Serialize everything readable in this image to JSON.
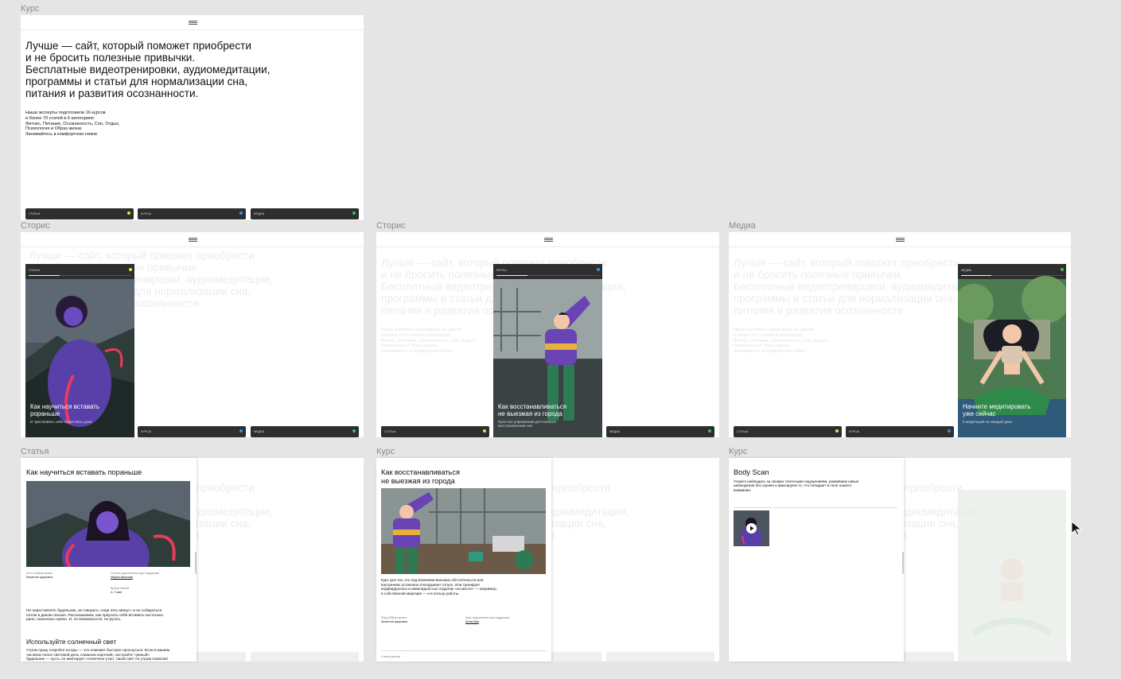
{
  "labels": {
    "kurs": "Курс",
    "storis": "Сторис",
    "media": "Медиа",
    "statya": "Статья"
  },
  "home": {
    "headline": "Лучше — сайт, который поможет приобрести\nи не бросить полезные привычки.\nБесплатные видеотренировки, аудиомедитации,\nпрограммы и статьи для нормализации сна,\nпитания и развития осознанности.",
    "intro": "Наши эксперты подготовили 16 курсов\nи более 70 статей в 6 категориях:\nФитнес, Питание, Осознанность, Сон, Отдых,\nПсихология и Образ жизни.\nЗанимайтесь в комфортном темпе."
  },
  "tabs": {
    "articles": "СТАТЬИ",
    "courses": "КУРСЫ",
    "media": "МЕДИА"
  },
  "colors": {
    "articles_dot": "#e8e04a",
    "courses_dot": "#3b8fe0",
    "media_dot": "#3cc25a",
    "tab_bg": "#2e2e2e"
  },
  "stories": {
    "s1": {
      "title": "Как научиться вставать\npораньше",
      "sub": "И чувствовать себя бодро весь день"
    },
    "s2": {
      "title": "Как восстанавливаться\nне выезжая из города",
      "sub": "Простые упражнения для полного\nвосстановления сил"
    },
    "s3": {
      "title": "Начните медитировать\nуже сейчас",
      "sub": "6 медитаций на каждый день"
    }
  },
  "article": {
    "title": "Как научиться вставать пораньше",
    "meta_cat_label": "#Сон #Образ жизни",
    "meta_cat_value": "Касается здоровья",
    "meta_expert_label": "Статья подготовлена при поддержке",
    "meta_expert_value": "Мария Иванова",
    "meta_time_label": "Время чтения",
    "meta_time_value": "4–7 мин",
    "lead": "Не переставлять будильник, не говорить «ещё пять минут» и не собираться\nпотом в диком спешке. Рассказываем, как приучить себя вставать настолько\nрано, насколько нужно. И, по возможности, не ругать.",
    "subhead": "Используйте солнечный свет",
    "body": "Утром сразу откройте шторы — это поможет быстрее проснуться. Если в вашем\nчасовом поясе световой день слишком короткий, настройте «умный»\nбудильник — пусть он имитирует солнечное утро: такой свет по утрам помогает"
  },
  "course": {
    "title": "Как восстанавливаться\nне выезжая из города",
    "desc": "Курс для тех, кто под влиянием внешних обстоятельств или\nвнутренних установок откладывает отпуск. Или тренирует\nиндивидуально и инвалидностью отдыхом «на месте» — например,\nв собственной квартире — и в пользу работы.",
    "meta_cat_label": "#Під #Образ жизни",
    "meta_cat_value": "Касается здоровья",
    "meta_expert_label": "Курс подготовлен при поддержке",
    "meta_expert_value": "Анна Ким",
    "footer": "Статьи уроков"
  },
  "media": {
    "title": "Body Scan",
    "desc": "Учимся наблюдать за своими телесными ощущениями, развиваем навык\nнаблюдения без оценки и фиксируем то, что попадает в поле нашего\nвнимания."
  }
}
